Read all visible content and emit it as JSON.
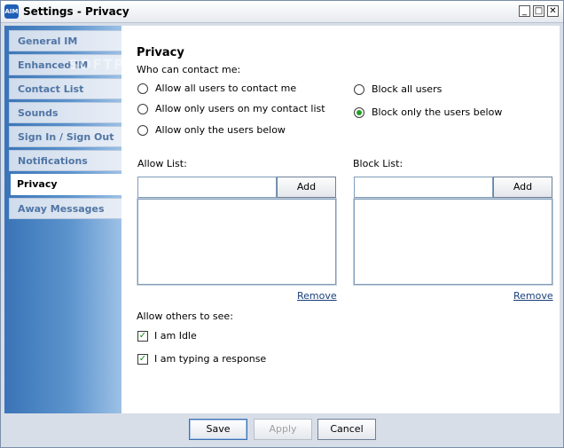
{
  "window": {
    "title": "Settings - Privacy",
    "app_icon_text": "AIM",
    "minimize_symbol": "_",
    "maximize_symbol": "□",
    "close_symbol": "✕"
  },
  "watermark": "SOFTPEDIA",
  "sidebar": {
    "items": [
      {
        "label": "General IM"
      },
      {
        "label": "Enhanced IM"
      },
      {
        "label": "Contact List"
      },
      {
        "label": "Sounds"
      },
      {
        "label": "Sign In / Sign Out"
      },
      {
        "label": "Notifications"
      },
      {
        "label": "Privacy"
      },
      {
        "label": "Away Messages"
      }
    ],
    "active": "Privacy"
  },
  "privacy": {
    "heading": "Privacy",
    "who_label": "Who can contact me:",
    "options_left": [
      {
        "label": "Allow all users to contact me",
        "selected": false
      },
      {
        "label": "Allow only users on my contact list",
        "selected": false
      },
      {
        "label": "Allow only the users below",
        "selected": false
      }
    ],
    "options_right": [
      {
        "label": "Block all users",
        "selected": false
      },
      {
        "label": "Block only the users below",
        "selected": true
      }
    ],
    "allow_list": {
      "label": "Allow List:",
      "input_value": "",
      "add_label": "Add",
      "remove_label": "Remove",
      "entries": []
    },
    "block_list": {
      "label": "Block List:",
      "input_value": "",
      "add_label": "Add",
      "remove_label": "Remove",
      "entries": []
    },
    "others_label": "Allow others to see:",
    "checks": [
      {
        "label": "I am Idle",
        "checked": true
      },
      {
        "label": "I am typing a response",
        "checked": true
      }
    ]
  },
  "footer": {
    "save_label": "Save",
    "apply_label": "Apply",
    "cancel_label": "Cancel"
  },
  "colors": {
    "sidebar_gradient_start": "#3a74b7",
    "nav_text": "#5075a4",
    "radio_selected": "#22a022",
    "link": "#1a3f7a"
  }
}
